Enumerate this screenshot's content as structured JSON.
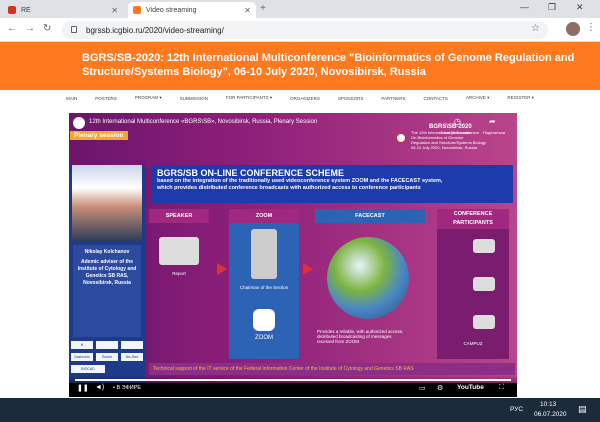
{
  "browser": {
    "tabs": [
      {
        "label": "RE"
      },
      {
        "label": "Video streaming"
      }
    ],
    "address": "bgrssb.icgbio.ru/2020/video-streaming/"
  },
  "site": {
    "banner_title": "BGRS/SB-2020: 12th International Multiconference \"Bioinformatics of Genome Regulation and Structure/Systems Biology\", 06-10 July 2020, Novosibirsk, Russia",
    "nav": [
      "MAIN",
      "POSTERS",
      "PROGRAM ▾",
      "SUBMISSION",
      "FOR PARTICIPANTS ▾",
      "ORGANIZERS",
      "SPONSORS",
      "PARTNERS",
      "CONTACTS",
      "ARCHIVE ▾",
      "REGISTER ▾"
    ]
  },
  "video": {
    "title": "12th International Multiconference «BGRS\\SB», Novosibirsk, Russia, Plenary Session",
    "watch_later": "Смотреть позже",
    "share": "Поделиться",
    "plenary": "Plenary session",
    "speaker_name": "Nikolay Kolchanov",
    "speaker_role": "Ademic adviser of the Institute of Cytology and Genetics SB RAS, Novosibirsk, Russia",
    "conf_lines": [
      "BGRS\\SB-2020",
      "The 12th International Multiconference",
      "On Bioinformatics of Genome",
      "Regulation and Structure/Systems Biology",
      "06-10 July 2020, Novosibirsk, Russia"
    ],
    "scheme_title": "BGRS/SB ON-LINE CONFERENCE SCHEME",
    "scheme_sub_1": "based on the integration of the traditionally used videoconference system ZOOM and the FACECAST system,",
    "scheme_sub_2": "which provides distributed conference broadcasts with authorized access to conference participants",
    "col_speaker": "SPEAKER",
    "col_zoom": "ZOOM",
    "col_facecast": "FACECAST",
    "col_participants": "CONFERENCE PARTICIPANTS",
    "label_report": "Report",
    "label_chairman": "Chairman of the Section",
    "label_zoom": "ZOOM",
    "label_facecast_note": "Provides a reliable, with authorized access, distributed broadcasting of messages received from ZOOM",
    "label_campuz": "CAMPUZ",
    "footer": "Technical support of the IT service of the Federal Information Center of the Institute of Cytology and Genetics SB RAS",
    "live": "• В ЭФИРЕ",
    "youtube": "YouTube",
    "sponsors": [
      "N",
      "Basinvest",
      "Roche",
      "Bio-Rad",
      "BIOCAD",
      ""
    ]
  },
  "os": {
    "lang": "РУС",
    "time": "10:13",
    "date": "06.07.2020"
  },
  "colors": {
    "orange": "#ff7a1f",
    "purple": "#8e1f7a",
    "blue": "#1d3baa"
  }
}
